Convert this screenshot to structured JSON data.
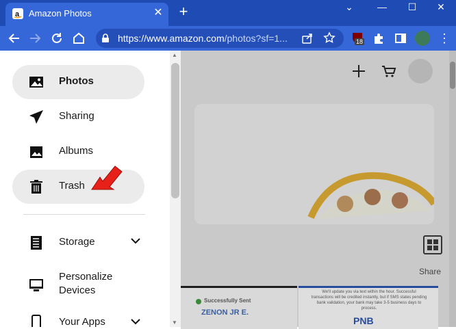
{
  "browser": {
    "tab_title": "Amazon Photos",
    "url_host": "https://www.amazon.com",
    "url_rest": "/photos?sf=1...",
    "extension_badge": "18"
  },
  "page": {
    "share_label": "Share",
    "card1_text": "Successfully Sent",
    "card1_name": "ZENON JR E.",
    "card2_text": "We'll update you via text within the hour. Successful transactions will be credited instantly, but if SMS states pending bank validation, your bank may take 3-5 business days to process.",
    "card2_logo": "PNB"
  },
  "sidebar": {
    "items": [
      {
        "label": "Photos",
        "icon": "photo-icon"
      },
      {
        "label": "Sharing",
        "icon": "send-icon"
      },
      {
        "label": "Albums",
        "icon": "albums-icon"
      },
      {
        "label": "Trash",
        "icon": "trash-icon"
      }
    ],
    "secondary": [
      {
        "label": "Storage",
        "icon": "storage-icon"
      },
      {
        "label": "Personalize",
        "label2": "Devices",
        "icon": "monitor-icon"
      },
      {
        "label": "Your Apps",
        "icon": "phone-icon"
      }
    ]
  },
  "colors": {
    "chrome_dark": "#1f4bb5",
    "chrome": "#3567d8",
    "arrow": "#e8201a"
  }
}
